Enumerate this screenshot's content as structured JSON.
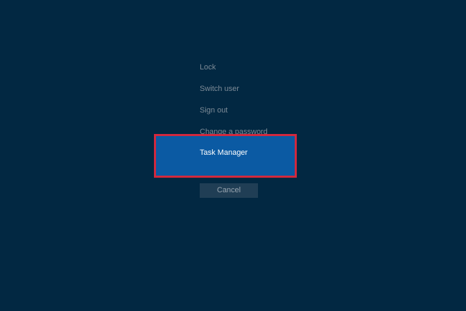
{
  "menu": {
    "items": [
      {
        "label": "Lock"
      },
      {
        "label": "Switch user"
      },
      {
        "label": "Sign out"
      },
      {
        "label": "Change a password"
      },
      {
        "label": "Task Manager"
      }
    ]
  },
  "cancel_label": "Cancel",
  "colors": {
    "background": "#022842",
    "selected_fill": "#0b5aa3",
    "highlight_border": "#d3283d",
    "muted_text": "#7d8b97",
    "cancel_bg": "#203e55"
  }
}
